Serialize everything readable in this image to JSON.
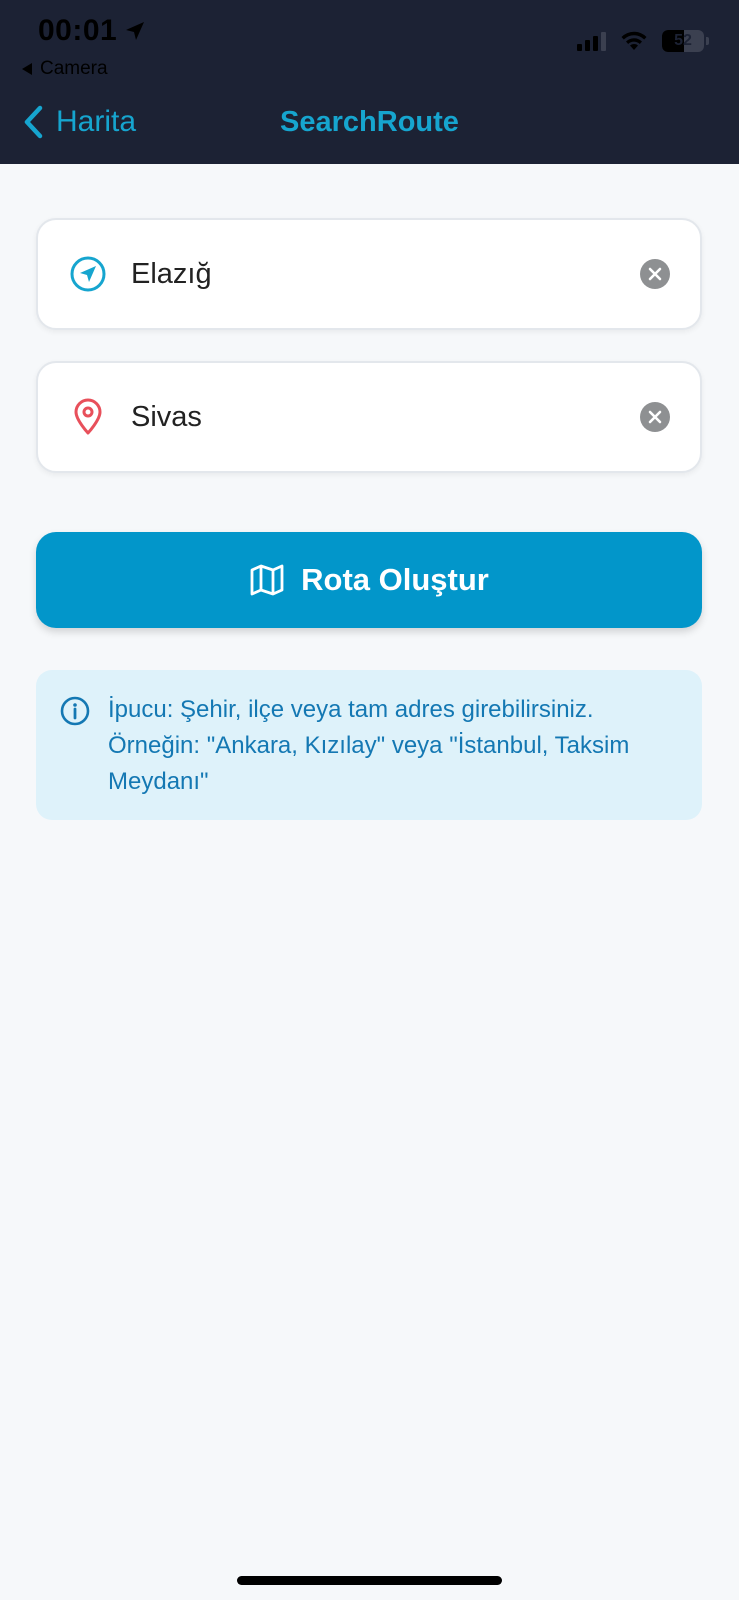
{
  "status_bar": {
    "time": "00:01",
    "back_app": "Camera",
    "battery": "52"
  },
  "nav": {
    "back_label": "Harita",
    "title": "SearchRoute"
  },
  "form": {
    "origin_value": "Elazığ",
    "destination_value": "Sivas"
  },
  "actions": {
    "create_route_label": "Rota Oluştur"
  },
  "tip": {
    "text": "İpucu: Şehir, ilçe veya tam adres girebilirsiniz. Örneğin: \"Ankara, Kızılay\" veya \"İstanbul, Taksim Meydanı\""
  },
  "colors": {
    "header_bg": "#1c2234",
    "accent": "#16a5cf",
    "button_bg": "#0296ca",
    "destination_icon": "#e8505b",
    "tip_bg": "#def2fa",
    "tip_text": "#1478b3"
  },
  "icons": {
    "origin": "navigation-arrow-icon",
    "destination": "map-pin-icon",
    "clear": "clear-x-icon",
    "button": "map-icon",
    "tip": "info-icon"
  }
}
